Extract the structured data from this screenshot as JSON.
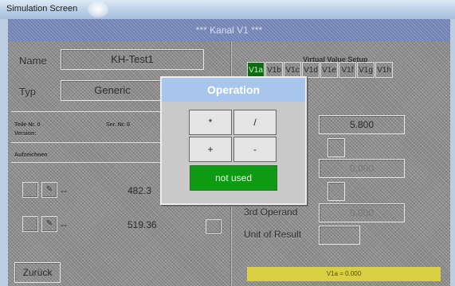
{
  "window": {
    "title": "Simulation Screen"
  },
  "header": {
    "title": "*** Kanal V1 ***"
  },
  "left": {
    "name_label": "Name",
    "name_value": "KH-Test1",
    "typ_label": "Typ",
    "typ_value": "Generic",
    "teile_nr": "Teile Nr. 0",
    "ser_nr": "Ser. Nr. 0",
    "version": "Version:",
    "aufzeichnen": "Aufzeichnen",
    "row1_dash": "--",
    "row1_value": "482.3",
    "row2_dash": "--",
    "row2_value": "519.36",
    "back_button": "Zurück"
  },
  "right": {
    "vv_title": "Virtual Value Setup",
    "tabs": [
      "V1a",
      "V1b",
      "V1c",
      "V1d",
      "V1e",
      "V1f",
      "V1g",
      "V1h"
    ],
    "active_tab": "V1a",
    "value1": "5.800",
    "value2": "0.000",
    "value3": "0.000",
    "third_operand_label": "3rd Operand",
    "unit_of_result_label": "Unit of Result",
    "footer_text": "V1a = 0.000"
  },
  "dialog": {
    "title": "Operation",
    "buttons": [
      "*",
      "/",
      "+",
      "-"
    ],
    "not_used": "not used"
  }
}
